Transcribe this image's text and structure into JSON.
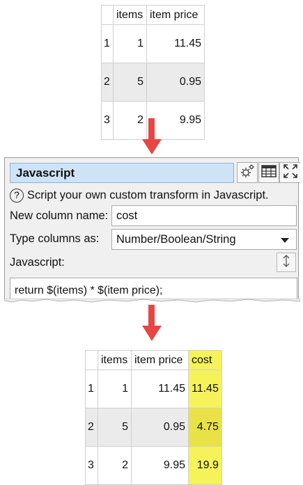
{
  "input_table": {
    "headers": [
      "items",
      "item price"
    ],
    "rows": [
      {
        "num": "1",
        "items": "1",
        "price": "11.45"
      },
      {
        "num": "2",
        "items": "5",
        "price": "0.95"
      },
      {
        "num": "3",
        "items": "2",
        "price": "9.95"
      }
    ]
  },
  "panel": {
    "title": "Javascript",
    "help_text": "Script your own custom transform in Javascript.",
    "help_icon": "?",
    "new_column_label": "New column name:",
    "new_column_value": "cost",
    "type_columns_label": "Type columns as:",
    "type_columns_value": "Number/Boolean/String",
    "javascript_label": "Javascript:",
    "code": "return $(items) * $(item price);",
    "icons": [
      "gear-icon",
      "table-icon",
      "expand-icon",
      "resize-icon"
    ]
  },
  "output_table": {
    "headers": [
      "items",
      "item price",
      "cost"
    ],
    "rows": [
      {
        "num": "1",
        "items": "1",
        "price": "11.45",
        "cost": "11.45"
      },
      {
        "num": "2",
        "items": "5",
        "price": "0.95",
        "cost": "4.75"
      },
      {
        "num": "3",
        "items": "2",
        "price": "9.95",
        "cost": "19.9"
      }
    ]
  },
  "colors": {
    "arrow": "#e84545",
    "highlight": "#f6f25a",
    "title_field": "#cfe3f7",
    "shaded_row": "#ebebeb"
  }
}
